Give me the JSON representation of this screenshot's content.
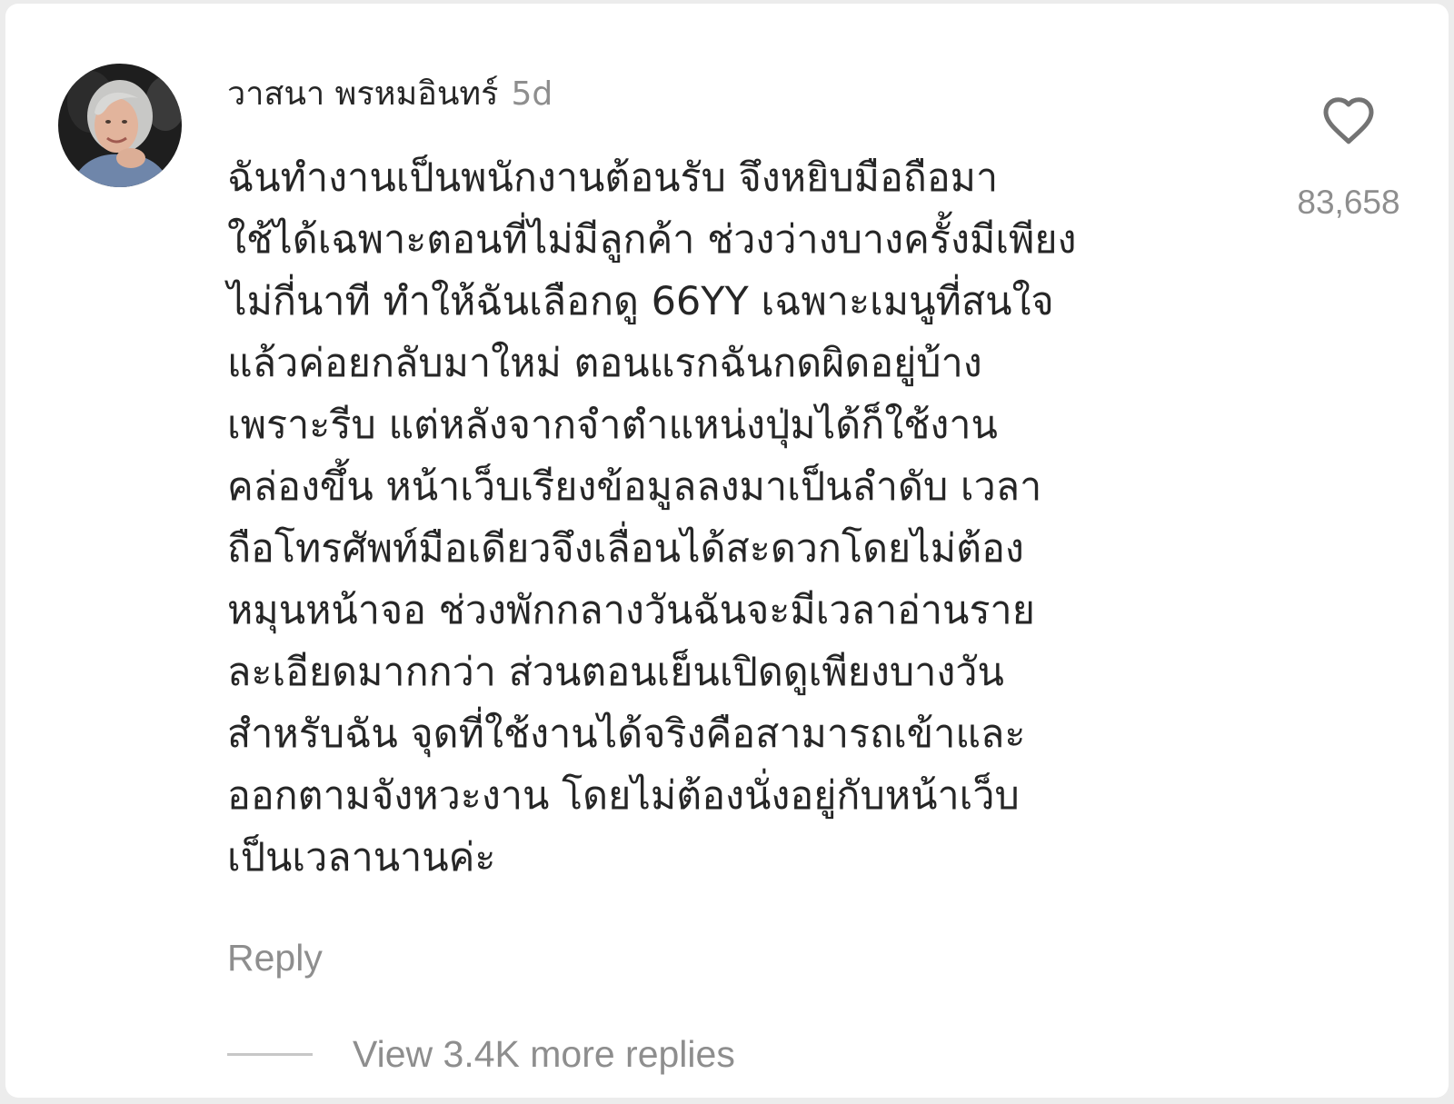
{
  "comment": {
    "username": "วาสนา พรหมอินทร์",
    "timestamp": "5d",
    "text_lines": [
      "ฉันทำงานเป็นพนักงานต้อนรับ จึงหยิบมือถือมา",
      "ใช้ได้เฉพาะตอนที่ไม่มีลูกค้า ช่วงว่างบางครั้งมีเพียง",
      "ไม่กี่นาที ทำให้ฉันเลือกดู 66YY เฉพาะเมนูที่สนใจ",
      "แล้วค่อยกลับมาใหม่ ตอนแรกฉันกดผิดอยู่บ้าง",
      "เพราะรีบ แต่หลังจากจำตำแหน่งปุ่มได้ก็ใช้งาน",
      "คล่องขึ้น หน้าเว็บเรียงข้อมูลลงมาเป็นลำดับ เวลา",
      "ถือโทรศัพท์มือเดียวจึงเลื่อนได้สะดวกโดยไม่ต้อง",
      "หมุนหน้าจอ ช่วงพักกลางวันฉันจะมีเวลาอ่านราย",
      "ละเอียดมากกว่า ส่วนตอนเย็นเปิดดูเพียงบางวัน",
      "สำหรับฉัน จุดที่ใช้งานได้จริงคือสามารถเข้าและ",
      "ออกตามจังหวะงาน โดยไม่ต้องนั่งอยู่กับหน้าเว็บ",
      "เป็นเวลานานค่ะ"
    ],
    "like_count": "83,658",
    "reply_label": "Reply",
    "view_replies_label": "View 3.4K more replies",
    "icons": {
      "like": "heart-outline-icon",
      "avatar": "user-avatar-photo"
    },
    "colors": {
      "primary_text": "#262626",
      "secondary_text": "#8e8e8e",
      "divider": "#c7c7c7",
      "background": "#ffffff"
    }
  }
}
